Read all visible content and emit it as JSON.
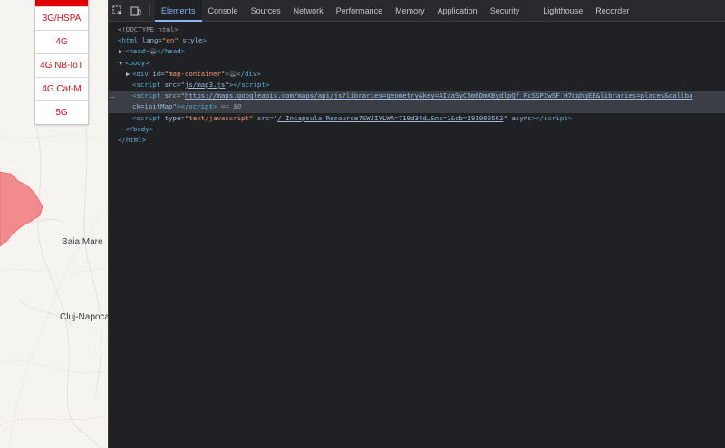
{
  "map": {
    "network_menu": [
      "3G/HSPA",
      "4G",
      "4G NB-IoT",
      "4G Cat-M",
      "5G"
    ],
    "cities": [
      "Baia Mare",
      "Cluj-Napoca"
    ],
    "colors": {
      "coverage": "#f0787d",
      "menu_text": "#d21414",
      "menu_active_bar": "#e00000"
    }
  },
  "devtools": {
    "toolbar_icons": [
      "inspect-element-icon",
      "device-toolbar-icon"
    ],
    "tabs": [
      "Elements",
      "Console",
      "Sources",
      "Network",
      "Performance",
      "Memory",
      "Application",
      "Security",
      "Lighthouse",
      "Recorder"
    ],
    "active_tab": "Elements",
    "dom": {
      "doctype": "<!DOCTYPE html>",
      "html_open_tag": "html",
      "html_lang_attr": "lang",
      "html_lang_val": "\"en\"",
      "html_style_attr": "style",
      "head_tag": "head",
      "head_ellipsis": "…",
      "body_tag": "body",
      "div_tag": "div",
      "div_id_attr": "id",
      "div_id_val": "\"map-container\"",
      "div_ellipsis": "…",
      "script1_src_attr": "src",
      "script1_src_val": "js/map3.js",
      "script2_src_val": "https://maps.googleapis.com/maps/api/js?libraries=geometry&key=AIzaSyC5m6DmXBydlpQf_PcSSPIwSF_H7dqhgEE&libraries=places&callba",
      "script2_src_val_cont": "ck=initMap",
      "selected_marker": "== $0",
      "selected_dots": "…",
      "script3_type_attr": "type",
      "script3_type_val": "\"text/javascript\"",
      "script3_src_val": "/_Incapsula_Resource?SWJIYLWA=719d34d…&ns=1&cb=291000562",
      "script3_async": "async",
      "body_close": "body",
      "html_close": "html",
      "script_tag": "script"
    }
  }
}
